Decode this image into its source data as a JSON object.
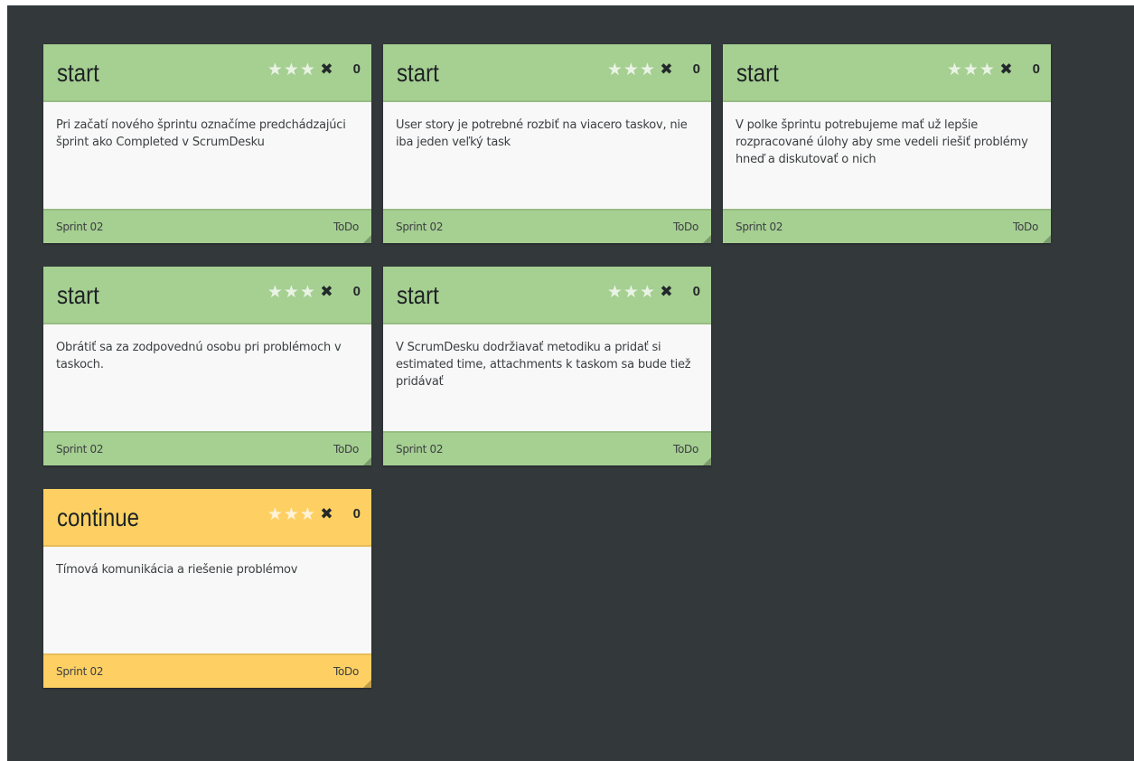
{
  "colors": {
    "board_background": "#33383b",
    "start_card": "#a6cf92",
    "continue_card": "#fed063",
    "card_body": "#f8f8f8"
  },
  "cards": [
    {
      "title": "start",
      "votes": "0",
      "text": "Pri začatí nového šprintu označíme predchádzajúci šprint ako Completed v ScrumDesku",
      "sprint": "Sprint 02",
      "status": "ToDo",
      "color": "green",
      "stars": 3
    },
    {
      "title": "start",
      "votes": "0",
      "text": "User story je potrebné rozbiť na viacero taskov, nie iba jeden veľký task",
      "sprint": "Sprint 02",
      "status": "ToDo",
      "color": "green",
      "stars": 3
    },
    {
      "title": "start",
      "votes": "0",
      "text": "V polke šprintu potrebujeme mať už lepšie rozpracované úlohy aby sme vedeli riešiť problémy hneď a diskutovať o nich",
      "sprint": "Sprint 02",
      "status": "ToDo",
      "color": "green",
      "stars": 3
    },
    {
      "title": "start",
      "votes": "0",
      "text": "Obrátiť sa za zodpovednú osobu pri problémoch v taskoch.",
      "sprint": "Sprint 02",
      "status": "ToDo",
      "color": "green",
      "stars": 3
    },
    {
      "title": "start",
      "votes": "0",
      "text": "V ScrumDesku dodržiavať metodiku a pridať si estimated time, attachments k taskom sa bude tiež pridávať",
      "sprint": "Sprint 02",
      "status": "ToDo",
      "color": "green",
      "stars": 3
    },
    {
      "title": "continue",
      "votes": "0",
      "text": "Tímová komunikácia a riešenie problémov",
      "sprint": "Sprint 02",
      "status": "ToDo",
      "color": "yellow",
      "stars": 3
    }
  ],
  "icons": {
    "rating": "star-icon",
    "delete": "close-icon",
    "resize": "resize-handle"
  }
}
